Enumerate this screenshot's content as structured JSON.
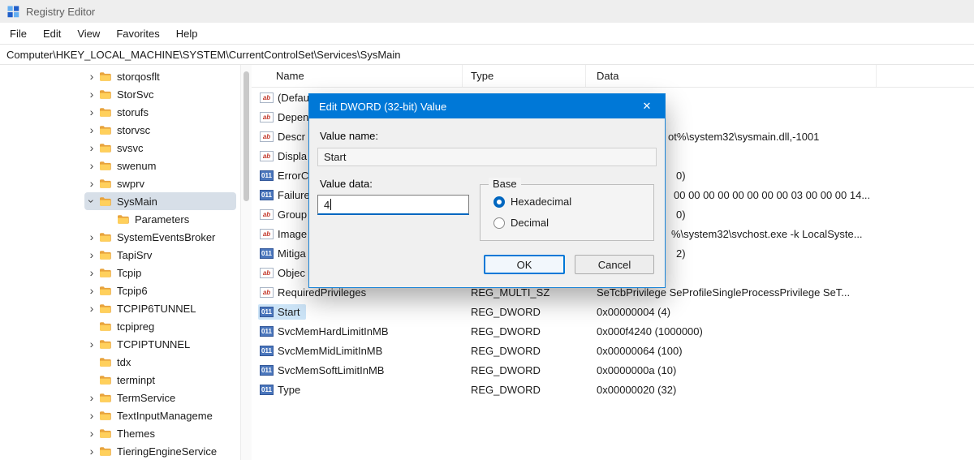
{
  "colors": {
    "accent": "#0078d7",
    "selection": "#cce4f7",
    "tree_selection": "#d7dfe8"
  },
  "window": {
    "title": "Registry Editor"
  },
  "menu": {
    "items": [
      "File",
      "Edit",
      "View",
      "Favorites",
      "Help"
    ]
  },
  "address_bar": {
    "path": "Computer\\HKEY_LOCAL_MACHINE\\SYSTEM\\CurrentControlSet\\Services\\SysMain"
  },
  "tree": {
    "items": [
      {
        "label": "storqosflt",
        "state": "collapsed",
        "indent": 0
      },
      {
        "label": "StorSvc",
        "state": "collapsed",
        "indent": 0
      },
      {
        "label": "storufs",
        "state": "collapsed",
        "indent": 0
      },
      {
        "label": "storvsc",
        "state": "collapsed",
        "indent": 0
      },
      {
        "label": "svsvc",
        "state": "collapsed",
        "indent": 0
      },
      {
        "label": "swenum",
        "state": "collapsed",
        "indent": 0
      },
      {
        "label": "swprv",
        "state": "collapsed",
        "indent": 0
      },
      {
        "label": "SysMain",
        "state": "expanded",
        "indent": 0,
        "selected": true
      },
      {
        "label": "Parameters",
        "state": "leaf",
        "indent": 1
      },
      {
        "label": "SystemEventsBroker",
        "state": "collapsed",
        "indent": 0
      },
      {
        "label": "TapiSrv",
        "state": "collapsed",
        "indent": 0
      },
      {
        "label": "Tcpip",
        "state": "collapsed",
        "indent": 0
      },
      {
        "label": "Tcpip6",
        "state": "collapsed",
        "indent": 0
      },
      {
        "label": "TCPIP6TUNNEL",
        "state": "collapsed",
        "indent": 0
      },
      {
        "label": "tcpipreg",
        "state": "leaf",
        "indent": 0
      },
      {
        "label": "TCPIPTUNNEL",
        "state": "collapsed",
        "indent": 0
      },
      {
        "label": "tdx",
        "state": "leaf",
        "indent": 0
      },
      {
        "label": "terminpt",
        "state": "leaf",
        "indent": 0
      },
      {
        "label": "TermService",
        "state": "collapsed",
        "indent": 0
      },
      {
        "label": "TextInputManageme",
        "state": "collapsed",
        "indent": 0
      },
      {
        "label": "Themes",
        "state": "collapsed",
        "indent": 0
      },
      {
        "label": "TieringEngineService",
        "state": "collapsed",
        "indent": 0
      }
    ]
  },
  "list": {
    "columns": [
      "Name",
      "Type",
      "Data"
    ],
    "rows": [
      {
        "name": "(Defaul",
        "icon": "string",
        "type": "",
        "data": ""
      },
      {
        "name": "Depen",
        "icon": "string",
        "type": "",
        "data": ""
      },
      {
        "name": "Descr",
        "icon": "string",
        "type": "",
        "data": "ot%\\system32\\sysmain.dll,-1001",
        "data_pad": 88
      },
      {
        "name": "Displa",
        "icon": "string",
        "type": "",
        "data": ""
      },
      {
        "name": "ErrorC",
        "icon": "dword",
        "type": "",
        "data": "0)",
        "data_pad": 98
      },
      {
        "name": "Failure",
        "icon": "dword",
        "type": "",
        "data": "00 00 00 00 00 00 00 00 03 00 00 00 14...",
        "data_pad": 95
      },
      {
        "name": "Group",
        "icon": "string",
        "type": "",
        "data": "0)",
        "data_pad": 98
      },
      {
        "name": "Image",
        "icon": "string",
        "type": "",
        "data": "%\\system32\\svchost.exe -k LocalSyste...",
        "data_pad": 92
      },
      {
        "name": "Mitiga",
        "icon": "dword",
        "type": "",
        "data": "2)",
        "data_pad": 98
      },
      {
        "name": "Objec",
        "icon": "string",
        "type": "",
        "data": ""
      },
      {
        "name": "RequiredPrivileges",
        "icon": "string",
        "type": "REG_MULTI_SZ",
        "data": "SeTcbPrivilege SeProfileSingleProcessPrivilege SeT..."
      },
      {
        "name": "Start",
        "icon": "dword",
        "type": "REG_DWORD",
        "data": "0x00000004 (4)",
        "selected": true
      },
      {
        "name": "SvcMemHardLimitInMB",
        "icon": "dword",
        "type": "REG_DWORD",
        "data": "0x000f4240 (1000000)"
      },
      {
        "name": "SvcMemMidLimitInMB",
        "icon": "dword",
        "type": "REG_DWORD",
        "data": "0x00000064 (100)"
      },
      {
        "name": "SvcMemSoftLimitInMB",
        "icon": "dword",
        "type": "REG_DWORD",
        "data": "0x0000000a (10)"
      },
      {
        "name": "Type",
        "icon": "dword",
        "type": "REG_DWORD",
        "data": "0x00000020 (32)"
      }
    ]
  },
  "dialog": {
    "title": "Edit DWORD (32-bit) Value",
    "close_icon": "✕",
    "value_name_label": "Value name:",
    "value_name": "Start",
    "value_data_label": "Value data:",
    "value_data": "4",
    "base": {
      "label": "Base",
      "options": [
        {
          "label": "Hexadecimal",
          "selected": true
        },
        {
          "label": "Decimal",
          "selected": false
        }
      ]
    },
    "buttons": {
      "ok": "OK",
      "cancel": "Cancel"
    }
  }
}
